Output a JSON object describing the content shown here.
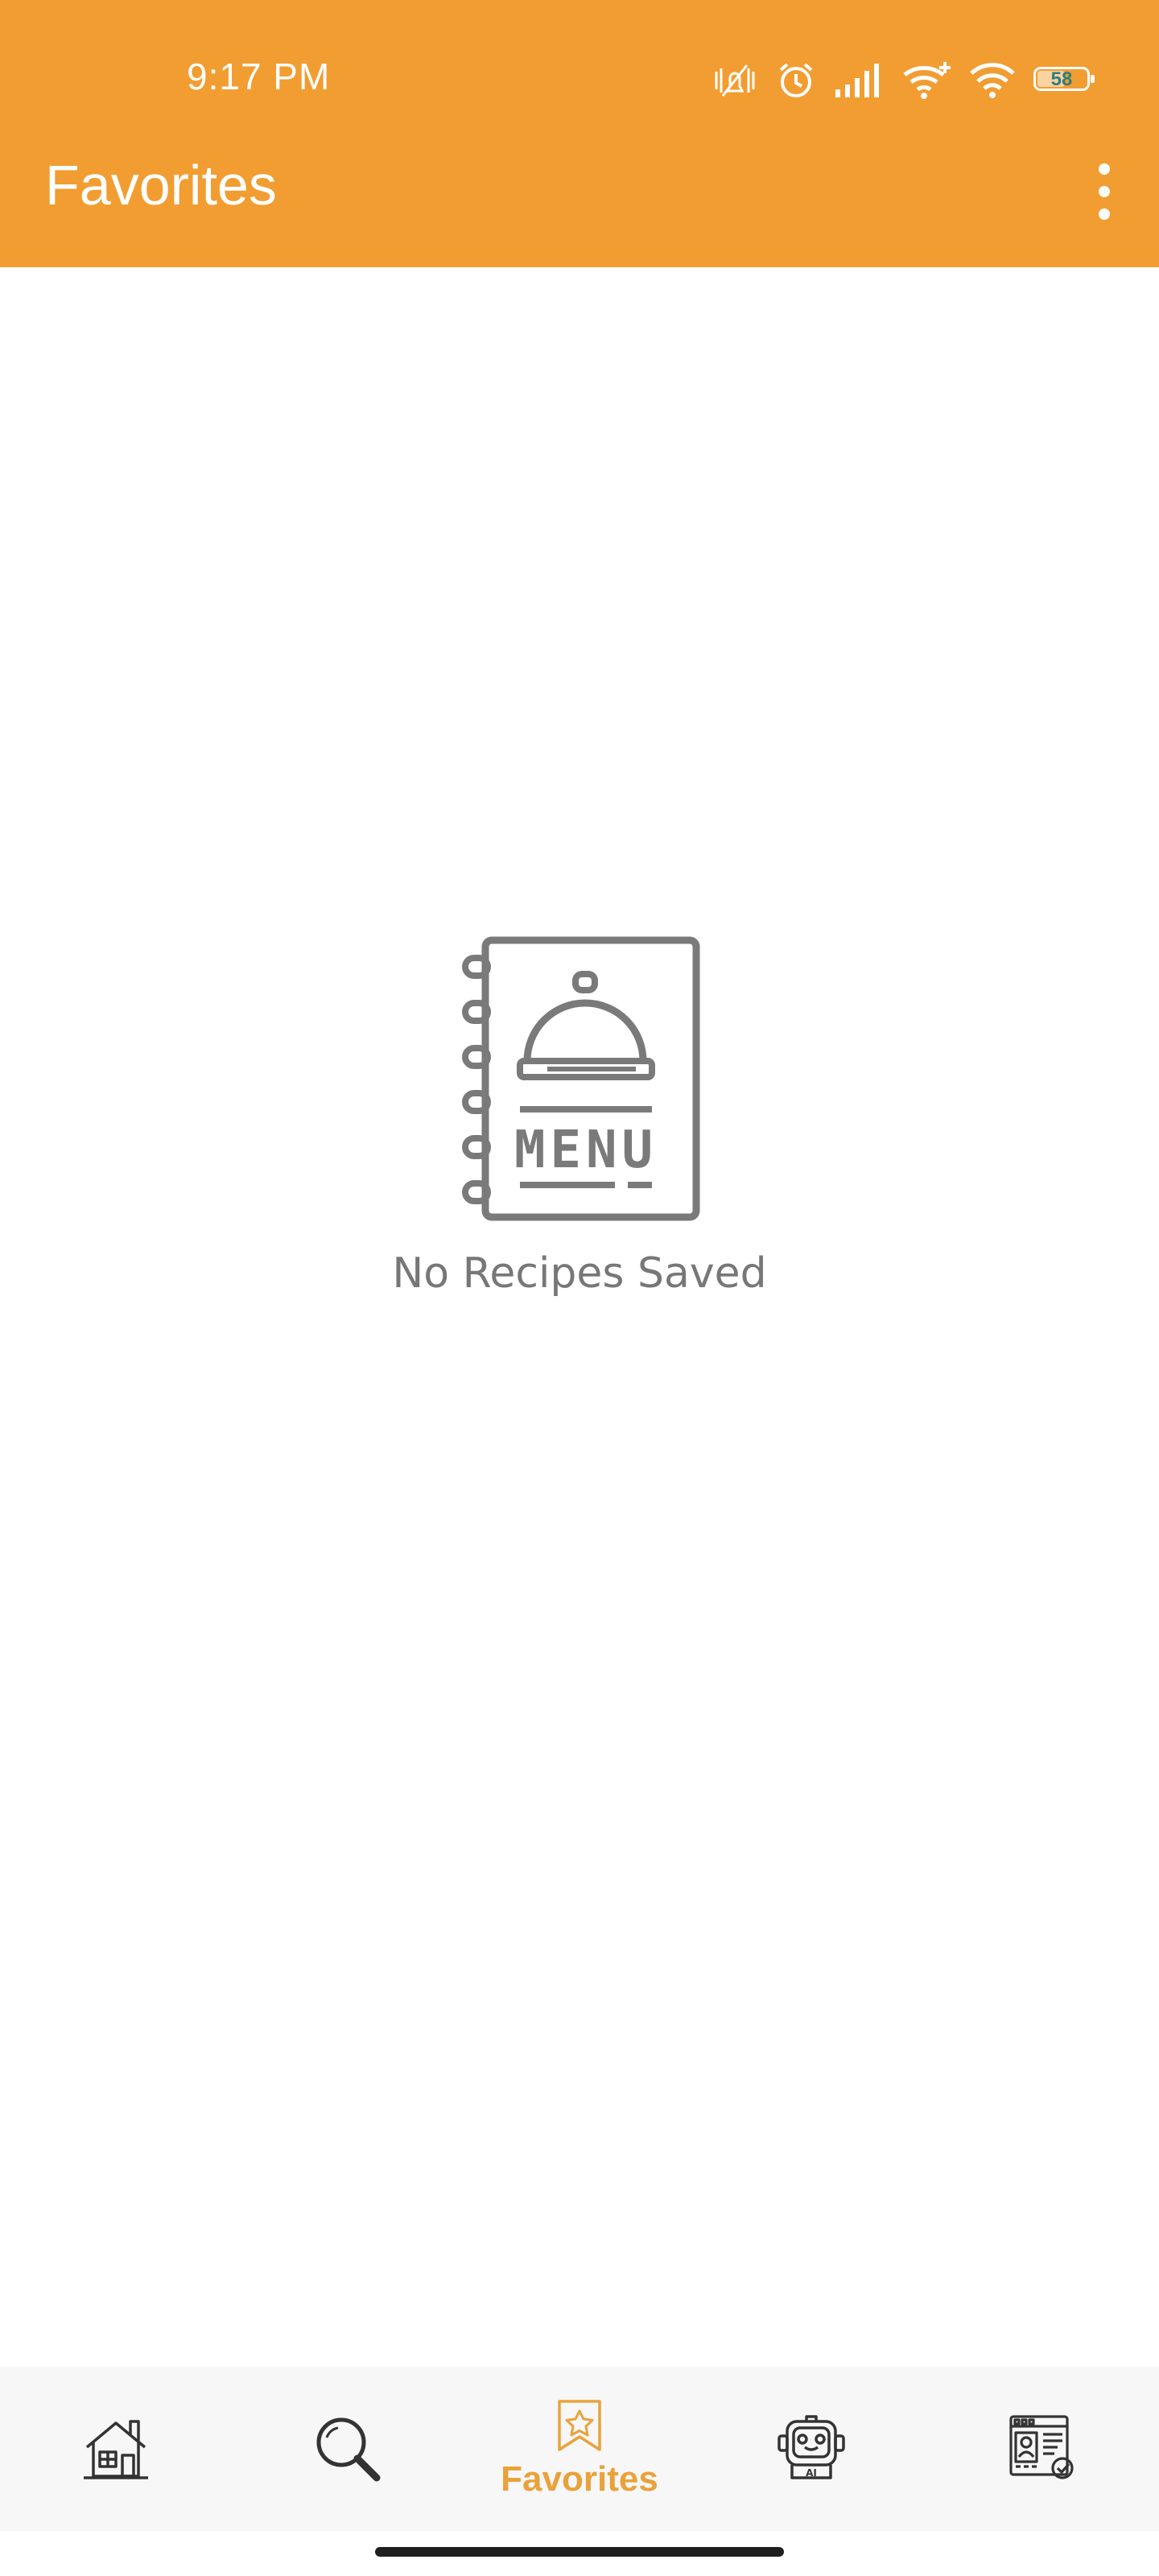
{
  "status_bar": {
    "time": "9:17 PM",
    "battery": "58",
    "icons": [
      "mute-vibrate-icon",
      "alarm-icon",
      "signal-icon",
      "wifi-plus-icon",
      "wifi-icon",
      "battery-icon"
    ]
  },
  "appbar": {
    "title": "Favorites",
    "menu_icon": "more-vert-icon",
    "background": "#F29D31"
  },
  "empty_state": {
    "icon": "menu-book-icon",
    "icon_text": "MENU",
    "message": "No Recipes Saved"
  },
  "bottom_nav": {
    "items": [
      {
        "icon": "home-icon",
        "label": ""
      },
      {
        "icon": "search-icon",
        "label": ""
      },
      {
        "icon": "bookmark-star-icon",
        "label": "Favorites",
        "active": true
      },
      {
        "icon": "ai-robot-icon",
        "label": "",
        "icon_text": "AI"
      },
      {
        "icon": "profile-document-icon",
        "label": ""
      }
    ],
    "active_color": "#E9A23B"
  }
}
